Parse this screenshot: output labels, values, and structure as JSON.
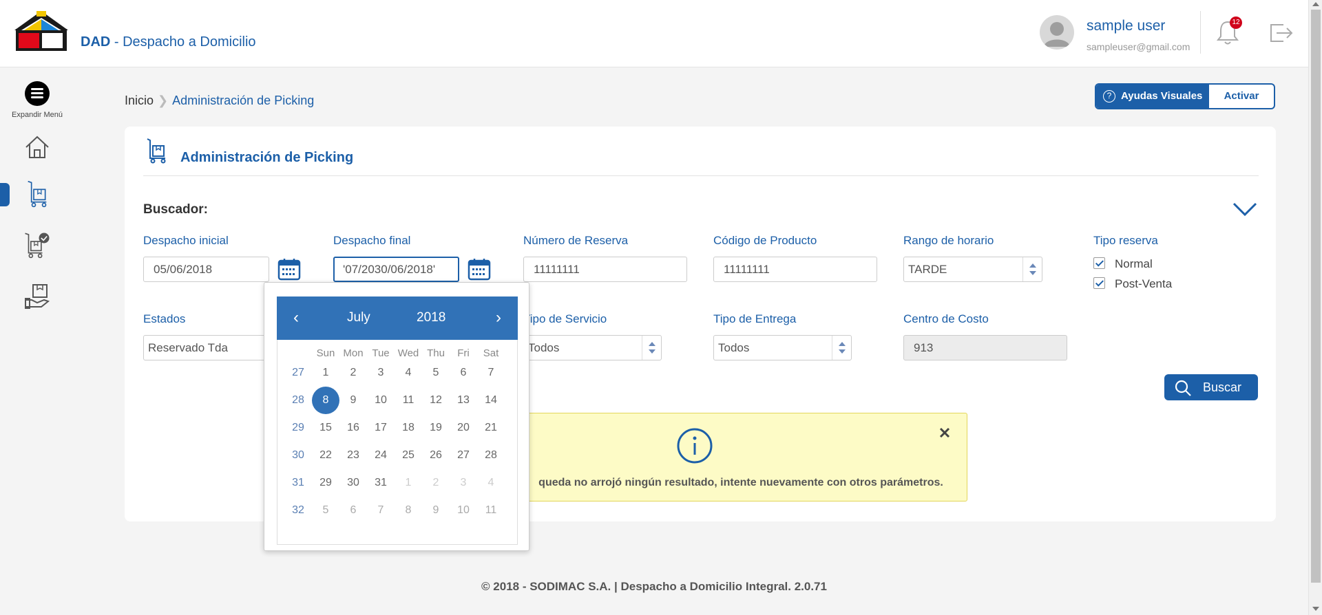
{
  "header": {
    "app_short": "DAD",
    "app_name": " - Despacho a Domicilio",
    "user_name": "sample user",
    "user_email": "sampleuser@gmail.com",
    "notification_count": "12"
  },
  "sidebar": {
    "expand_label": "Expandir Menú",
    "items": [
      "home-icon",
      "picking-cart-icon",
      "cart-check-icon",
      "hand-box-icon"
    ]
  },
  "breadcrumb": {
    "home": "Inicio",
    "current": "Administración de Picking"
  },
  "help": {
    "label": "Ayudas Visuales",
    "action": "Activar"
  },
  "card": {
    "title": "Administración de Picking",
    "section": "Buscador:"
  },
  "filters": {
    "despacho_inicial": {
      "label": "Despacho inicial",
      "value": "05/06/2018"
    },
    "despacho_final": {
      "label": "Despacho final",
      "value": "'07/2030/06/2018'"
    },
    "numero_reserva": {
      "label": "Número de Reserva",
      "value": "11111111"
    },
    "codigo_producto": {
      "label": "Código de Producto",
      "value": "11111111"
    },
    "rango_horario": {
      "label": "Rango de horario",
      "value": "TARDE"
    },
    "tipo_reserva": {
      "label": "Tipo reserva",
      "options": [
        "Normal",
        "Post-Venta"
      ]
    },
    "estados": {
      "label": "Estados",
      "value": "Reservado Tda"
    },
    "tipo_servicio": {
      "label": "Tipo de Servicio",
      "value": "Todos"
    },
    "tipo_entrega": {
      "label": "Tipo de Entrega",
      "value": "Todos"
    },
    "centro_costo": {
      "label": "Centro de Costo",
      "value": "913"
    }
  },
  "search_button": "Buscar",
  "alert": {
    "text": "queda no arrojó ningún resultado, intente nuevamente con otros parámetros."
  },
  "datepicker": {
    "month": "July",
    "year": "2018",
    "prev": "‹",
    "next": "›",
    "weekdays": [
      "Sun",
      "Mon",
      "Tue",
      "Wed",
      "Thu",
      "Fri",
      "Sat"
    ],
    "weeks": [
      {
        "week": "27",
        "days": [
          "1",
          "2",
          "3",
          "4",
          "5",
          "6",
          "7"
        ]
      },
      {
        "week": "28",
        "days": [
          "8",
          "9",
          "10",
          "11",
          "12",
          "13",
          "14"
        ]
      },
      {
        "week": "29",
        "days": [
          "15",
          "16",
          "17",
          "18",
          "19",
          "20",
          "21"
        ]
      },
      {
        "week": "30",
        "days": [
          "22",
          "23",
          "24",
          "25",
          "26",
          "27",
          "28"
        ]
      },
      {
        "week": "31",
        "days": [
          "29",
          "30",
          "31",
          "1",
          "2",
          "3",
          "4"
        ]
      },
      {
        "week": "32",
        "days": [
          "5",
          "6",
          "7",
          "8",
          "9",
          "10",
          "11"
        ]
      }
    ],
    "selected": "8"
  },
  "footer": "© 2018 - SODIMAC S.A. | Despacho a Domicilio Integral. 2.0.71",
  "colors": {
    "primary": "#1c5fa8",
    "calendar_header": "#3172b7",
    "alert_bg": "#fdfbc6"
  }
}
